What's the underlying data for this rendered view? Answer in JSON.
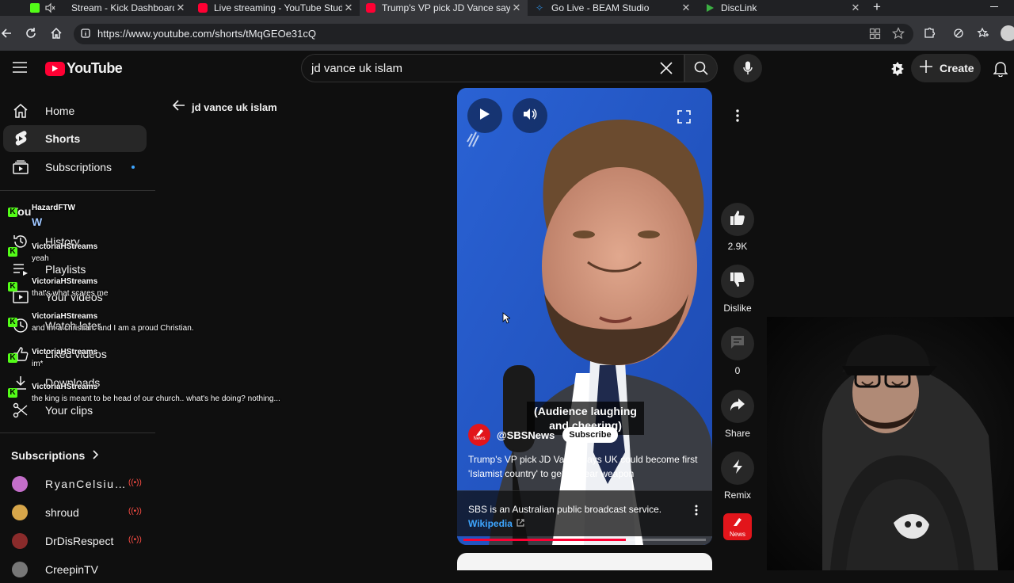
{
  "browser": {
    "tabs": [
      {
        "title": "Stream - Kick Dashboard",
        "color": "#53fc18",
        "active": false
      },
      {
        "title": "Live streaming - YouTube Studio",
        "color": "#ff0033",
        "active": false
      },
      {
        "title": "Trump's VP pick JD Vance says UK",
        "color": "#ff0033",
        "active": true
      },
      {
        "title": "Go Live - BEAM Studio",
        "color": "#2b88d8",
        "active": false
      },
      {
        "title": "DiscLink",
        "color": "#3cb043",
        "active": false
      }
    ],
    "url": "https://www.youtube.com/shorts/tMqGEOe31cQ"
  },
  "header": {
    "logo_text": "YouTube",
    "search_value": "jd vance uk islam",
    "create_label": "Create"
  },
  "sidebar": {
    "main": [
      {
        "label": "Home",
        "icon": "home-icon",
        "active": false
      },
      {
        "label": "Shorts",
        "icon": "shorts-icon",
        "active": true
      },
      {
        "label": "Subscriptions",
        "icon": "subscriptions-icon",
        "active": false
      }
    ],
    "you_heading": "You",
    "you_items": [
      {
        "label": "History",
        "icon": "history-icon"
      },
      {
        "label": "Playlists",
        "icon": "playlists-icon"
      },
      {
        "label": "Your videos",
        "icon": "your-videos-icon"
      },
      {
        "label": "Watch later",
        "icon": "watch-later-icon"
      },
      {
        "label": "Liked videos",
        "icon": "liked-videos-icon"
      },
      {
        "label": "Downloads",
        "icon": "downloads-icon"
      },
      {
        "label": "Your clips",
        "icon": "clips-icon"
      }
    ],
    "subscriptions_heading": "Subscriptions",
    "subscriptions": [
      {
        "name": "RyanCelsiu…",
        "avatar_color": "#c36ec9",
        "live": true
      },
      {
        "name": "shroud",
        "avatar_color": "#d7a64a",
        "live": true
      },
      {
        "name": "DrDisRespect",
        "avatar_color": "#8a2b2b",
        "live": true
      },
      {
        "name": "CreepinTV",
        "avatar_color": "#777777",
        "live": false
      }
    ]
  },
  "back_label": "jd vance uk islam",
  "chat": [
    {
      "user": "HazardFTW",
      "message": ""
    },
    {
      "user": "VictoriaHStreams",
      "message": "yeah"
    },
    {
      "user": "VictoriaHStreams",
      "message": "that's what scares me"
    },
    {
      "user": "VictoriaHStreams",
      "message": "and im a christian. and I am a proud Christian."
    },
    {
      "user": "VictoriaHStreams",
      "message": "im*"
    },
    {
      "user": "VictoriaHStreams",
      "message": "the king is meant to be head of our church.. what's he doing? nothing..."
    }
  ],
  "short": {
    "caption": "(Audience laughing and cheering)",
    "channel": "@SBSNews",
    "subscribe_label": "Subscribe",
    "title": "Trump's VP pick JD Vance says UK could become first 'Islamist country' to get nuclear weapon",
    "info_text": "SBS is an Australian public broadcast service.",
    "info_link": "Wikipedia",
    "progress": 0.67,
    "channel_badge_text": "News"
  },
  "actions": {
    "likes": "2.9K",
    "dislike_label": "Dislike",
    "comments": "0",
    "share_label": "Share",
    "remix_label": "Remix"
  },
  "colors": {
    "yt_red": "#ff0033",
    "sbs_red": "#e2151b",
    "kick_green": "#53fc18"
  }
}
